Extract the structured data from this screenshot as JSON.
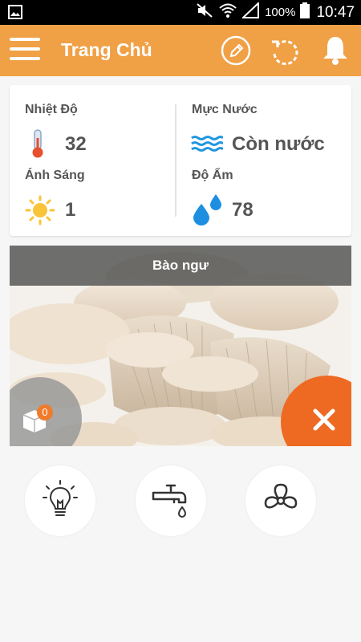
{
  "status_bar": {
    "battery_percent": "100%",
    "time": "10:47",
    "icons": [
      "gallery-icon",
      "mute-icon",
      "wifi-icon",
      "signal-icon",
      "battery-icon"
    ]
  },
  "app_bar": {
    "title": "Trang Chủ",
    "background_color": "#f0a045",
    "icons": [
      "menu-icon",
      "edit-icon",
      "refresh-icon",
      "bell-icon"
    ]
  },
  "sensors": {
    "temperature": {
      "label": "Nhiệt Độ",
      "value": "32",
      "icon": "thermometer-icon"
    },
    "water_level": {
      "label": "Mực Nước",
      "value": "Còn nước",
      "icon": "water-waves-icon"
    },
    "light": {
      "label": "Ánh Sáng",
      "value": "1",
      "icon": "sun-icon"
    },
    "humidity": {
      "label": "Độ Ẩm",
      "value": "78",
      "icon": "water-drops-icon"
    }
  },
  "mushroom": {
    "name": "Bào ngư",
    "box_count": "0",
    "accent_color": "#ee6a22"
  },
  "controls": [
    {
      "name": "light",
      "icon": "lightbulb-icon"
    },
    {
      "name": "pump",
      "icon": "faucet-icon"
    },
    {
      "name": "fan",
      "icon": "fan-icon"
    }
  ]
}
